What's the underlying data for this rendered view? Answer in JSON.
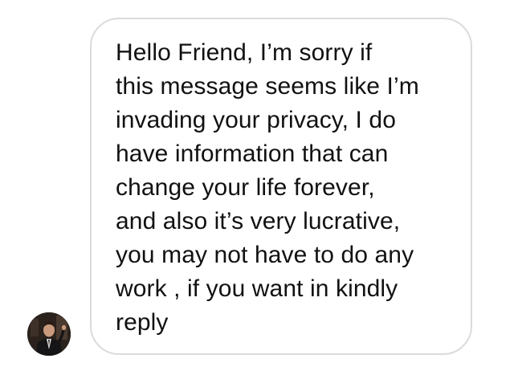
{
  "conversation": {
    "sender_avatar_icon": "person-avatar-icon",
    "message": {
      "lines": [
        "Hello Friend, I’m sorry if",
        "this message seems like I’m",
        "invading your privacy, I do",
        "have information that can",
        "change your life forever,",
        "and also it’s very lucrative,",
        "you may not have to do any",
        "work , if you want in kindly",
        "reply"
      ]
    }
  },
  "colors": {
    "background": "#ffffff",
    "bubble_border": "#dbdbdb",
    "text": "#111111"
  }
}
